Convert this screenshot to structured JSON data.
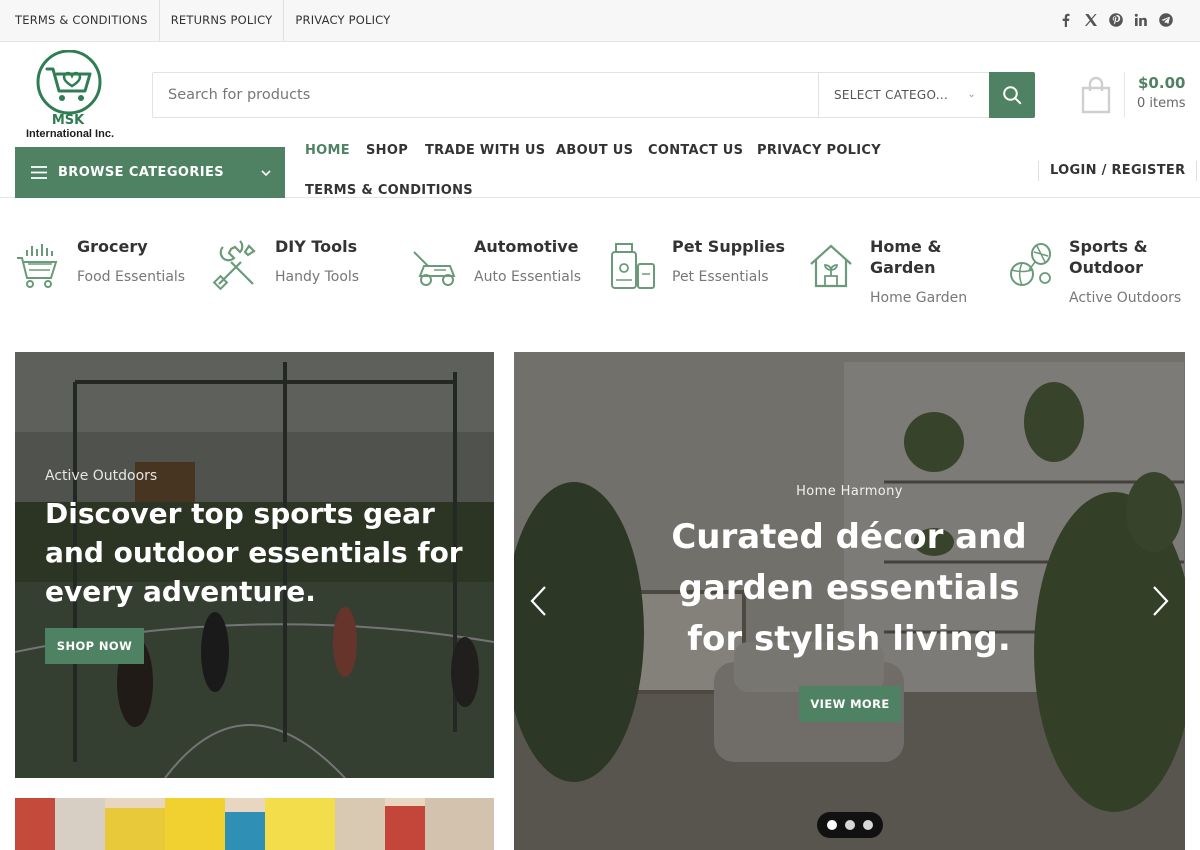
{
  "topbar": {
    "links": [
      "TERMS & CONDITIONS",
      "RETURNS POLICY",
      "PRIVACY POLICY"
    ],
    "social_icons": [
      "facebook-icon",
      "x-twitter-icon",
      "pinterest-icon",
      "linkedin-icon",
      "telegram-icon"
    ]
  },
  "brand": {
    "logo_text": "MSK",
    "company": "International Inc.",
    "color": "#2f7d52"
  },
  "search": {
    "placeholder": "Search for products",
    "category_label": "SELECT CATEGO...",
    "button_icon": "search-icon"
  },
  "cart": {
    "total": "$0.00",
    "count": "0 items",
    "icon": "shopping-bag-icon"
  },
  "nav": {
    "browse_label": "BROWSE CATEGORIES",
    "items": [
      "HOME",
      "SHOP",
      "TRADE WITH US",
      "ABOUT US",
      "CONTACT US",
      "PRIVACY POLICY",
      "TERMS & CONDITIONS"
    ],
    "active": "HOME",
    "login_label": "LOGIN / REGISTER"
  },
  "categories": [
    {
      "title": "Grocery",
      "subtitle": "Food Essentials",
      "icon": "shopping-cart-icon"
    },
    {
      "title": "DIY Tools",
      "subtitle": "Handy Tools",
      "icon": "tools-icon"
    },
    {
      "title": "Automotive",
      "subtitle": "Auto Essentials",
      "icon": "lawn-mower-icon"
    },
    {
      "title": "Pet Supplies",
      "subtitle": "Pet Essentials",
      "icon": "pet-food-icon"
    },
    {
      "title": "Home & Garden",
      "subtitle": "Home Garden",
      "icon": "house-plant-icon"
    },
    {
      "title": "Sports & Outdoor",
      "subtitle": "Active Outdoors",
      "icon": "sports-balls-icon"
    }
  ],
  "banners": {
    "left": {
      "subtitle": "Active Outdoors",
      "title": "Discover top sports gear and outdoor essentials for every adventure.",
      "button": "SHOP NOW"
    },
    "right": {
      "subtitle": "Home Harmony",
      "title": "Curated décor and garden essentials for stylish living.",
      "button": "VIEW MORE",
      "slides": 3,
      "active_slide": 1
    }
  },
  "colors": {
    "accent": "#4f8262",
    "topbar_bg": "#f7f7f7"
  }
}
